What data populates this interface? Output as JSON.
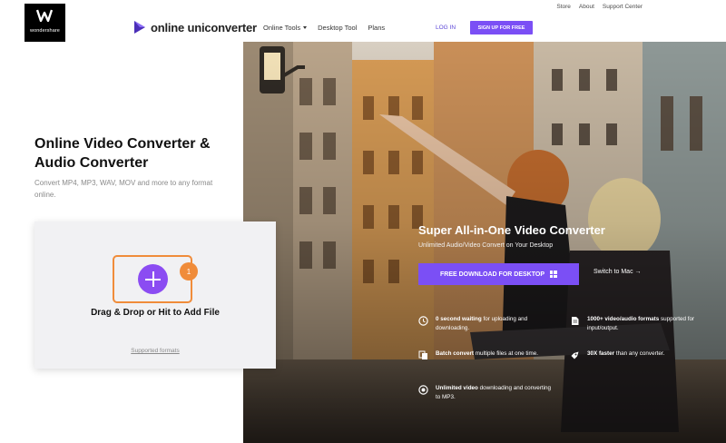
{
  "top_links": [
    "Store",
    "About",
    "Support Center"
  ],
  "logo": {
    "text": "wondershare"
  },
  "brand": {
    "name": "online uniconverter"
  },
  "nav": {
    "items": [
      {
        "label": "Online Tools",
        "dropdown": true
      },
      {
        "label": "Desktop Tool"
      },
      {
        "label": "Plans"
      }
    ],
    "login": "LOG IN",
    "signup": "SIGN UP FOR FREE"
  },
  "hero": {
    "headline_line1": "Online Video Converter &",
    "headline_line2": "Audio Converter",
    "subline": "Convert MP4, MP3, WAV, MOV and more to any format online."
  },
  "upload": {
    "badge": "1",
    "drop_text": "Drag & Drop or Hit to Add File",
    "formats_link": "Supported formats"
  },
  "promo": {
    "title": "Super All-in-One Video Converter",
    "subtitle": "Unlimited Audio/Video Convert on Your Desktop",
    "download_button": "FREE DOWNLOAD FOR DESKTOP",
    "switch": "Switch to Mac →"
  },
  "features": [
    {
      "bold": "0 second waiting",
      "rest": " for uploading and downloading.",
      "icon": "clock-icon"
    },
    {
      "bold": "1000+ video/audio formats",
      "rest": " supported for input/output.",
      "icon": "file-icon"
    },
    {
      "bold": "Batch convert",
      "rest": " multiple files at one time.",
      "icon": "copy-icon"
    },
    {
      "bold": "30X faster",
      "rest": " than any converter.",
      "icon": "rocket-icon"
    },
    {
      "bold": "Unlimited video",
      "rest": " downloading and converting to MP3.",
      "icon": "disc-icon"
    }
  ],
  "colors": {
    "accent_purple": "#7b4ff5",
    "plus_purple": "#8b4cf2",
    "orange": "#f08c3a"
  }
}
